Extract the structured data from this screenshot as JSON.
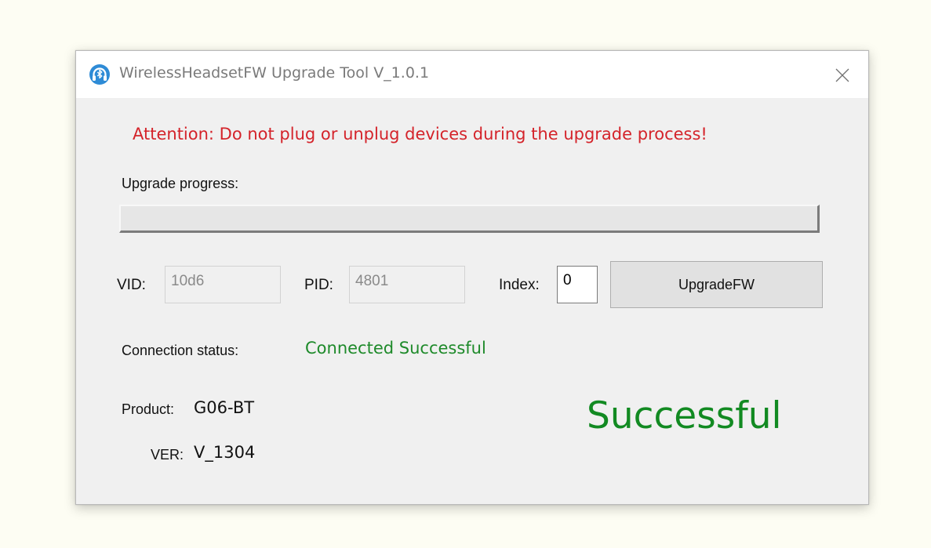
{
  "window": {
    "title": "WirelessHeadsetFW Upgrade Tool V_1.0.1",
    "app_icon": "bluetooth-headset-icon",
    "close_icon": "close-icon"
  },
  "attention": "Attention: Do not plug or unplug devices during the upgrade process!",
  "progress": {
    "label": "Upgrade progress:",
    "value": 0
  },
  "device": {
    "vid_label": "VID:",
    "vid_value": "10d6",
    "pid_label": "PID:",
    "pid_value": "4801",
    "index_label": "Index:",
    "index_value": "0"
  },
  "upgrade_button": "UpgradeFW",
  "connection": {
    "label": "Connection status:",
    "value": "Connected Successful"
  },
  "product": {
    "label": "Product:",
    "value": "G06-BT"
  },
  "version": {
    "label": "VER:",
    "value": "V_1304"
  },
  "result": "Successful",
  "colors": {
    "attention": "#d4232a",
    "status_green": "#1e8a2a",
    "result_green": "#128a22",
    "progress_fill": "#06b025"
  }
}
